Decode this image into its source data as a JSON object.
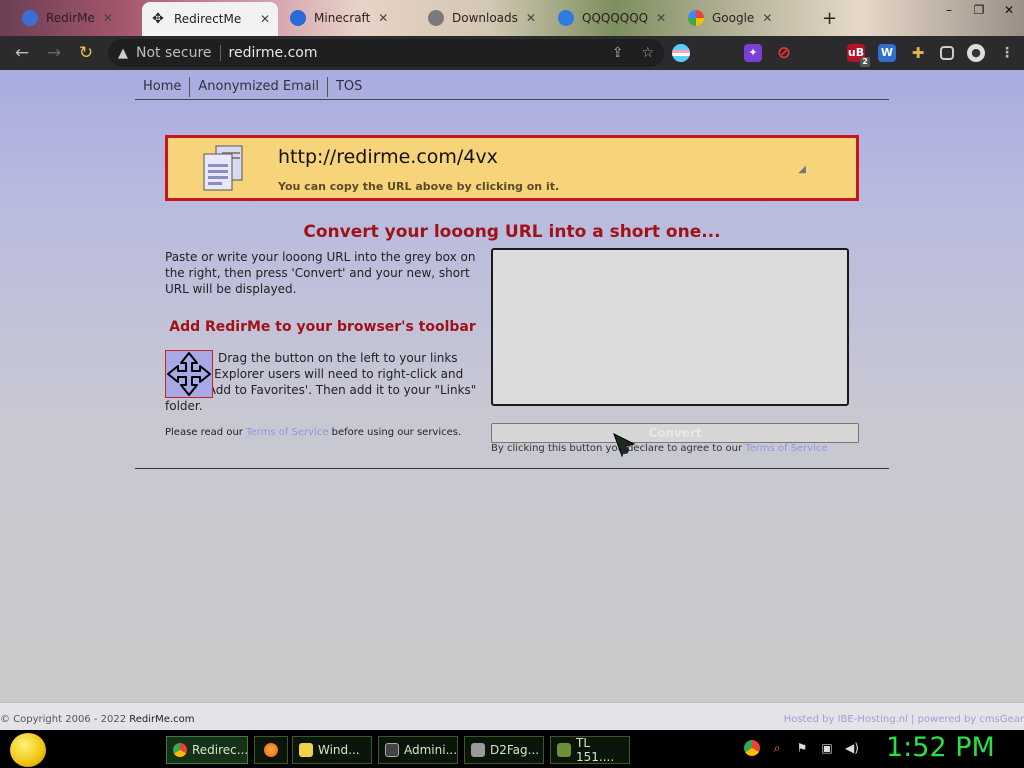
{
  "browser": {
    "tabs": [
      {
        "label": "RedirMe",
        "active": false
      },
      {
        "label": "RedirectMe",
        "active": true
      },
      {
        "label": "Minecraft",
        "active": false
      },
      {
        "label": "Downloads",
        "active": false
      },
      {
        "label": "QQQQQQQ",
        "active": false
      },
      {
        "label": "Google",
        "active": false
      }
    ],
    "new_tab_label": "+",
    "security_label": "Not secure",
    "url": "redirme.com",
    "badge_count": "2"
  },
  "site": {
    "nav": [
      "Home",
      "Anonymized Email",
      "TOS"
    ],
    "short_url": "http://redirme.com/4vx",
    "copy_hint": "You can copy the URL above by clicking on it.",
    "heading": "Convert your looong URL into a short one...",
    "intro": "Paste or write your looong URL into the grey box on the right, then press 'Convert' and your new, short URL will be displayed.",
    "toolbar_heading": "Add RedirMe to your browser's toolbar",
    "drag_text": "Drag the button on the left to your links toolbar. Explorer users will need to right-click and select 'Add to Favorites'. Then add it to your \"Links\" folder.",
    "terms_prefix": "Please read our ",
    "terms_link": "Terms of Service",
    "terms_suffix": " before using our services.",
    "input_value": "",
    "convert_label": "Convert",
    "agree_prefix": "By clicking this button you declare to agree to our ",
    "agree_link": "Terms of Service"
  },
  "footer": {
    "copyright_prefix": "© Copyright 2006 - 2022 ",
    "copyright_brand": "RedirMe.com",
    "hosted": "Hosted by IBE-Hosting.nl | powered by cmsGear"
  },
  "taskbar": {
    "tasks": [
      {
        "label": "Redirec...",
        "active": true,
        "color": "#e8473a"
      },
      {
        "label": "",
        "active": false,
        "color": "#ff7a1a"
      },
      {
        "label": "Wind...",
        "active": false,
        "color": "#f0d24a"
      },
      {
        "label": "Admini...",
        "active": false,
        "color": "#444444"
      },
      {
        "label": "D2Fag...",
        "active": false,
        "color": "#9a9a9a"
      },
      {
        "label": "TL 151....",
        "active": false,
        "color": "#6b8f3a"
      }
    ],
    "clock": "1:52 PM"
  },
  "colors": {
    "accent_red": "#c8141a",
    "url_box_bg": "#f7d37a",
    "link_blue": "#8f96dc",
    "clock_green": "#29e04a"
  }
}
